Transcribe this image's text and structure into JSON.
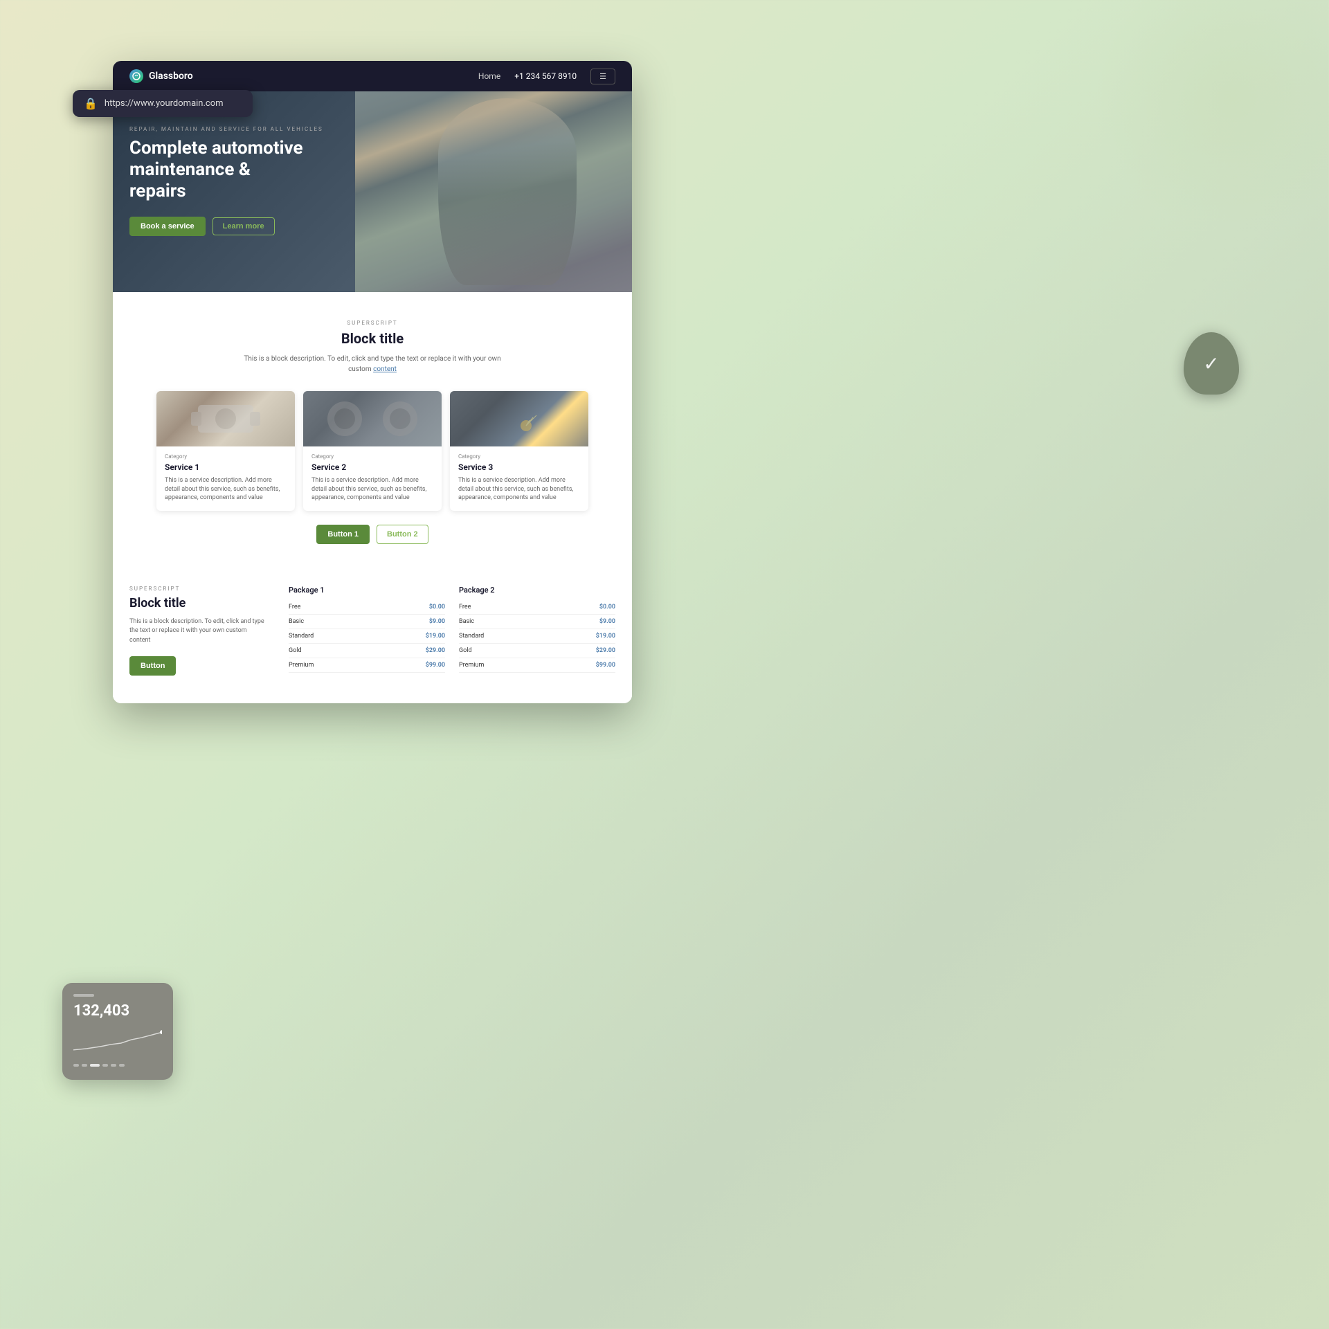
{
  "background": {
    "gradient": "linear-gradient(135deg, #e8e8c8 0%, #d4e8c8 40%, #c8d8c0 70%, #d0e0c0 100%)"
  },
  "browser": {
    "url": "https://www.yourdomain.com"
  },
  "nav": {
    "logo": "Glassboro",
    "home_link": "Home",
    "phone": "+1 234 567 8910",
    "button_label": "☰"
  },
  "hero": {
    "superscript": "REPAIR, MAINTAIN AND SERVICE FOR ALL VEHICLES",
    "title": "Complete automotive maintenance & repairs",
    "book_button": "Book a service",
    "learn_button": "Learn more"
  },
  "services": {
    "superscript": "SUPERSCRIPT",
    "title": "Block title",
    "description_part1": "This is a block description. To edit, click and type the text or replace it with your own custom",
    "description_link": "content",
    "cards": [
      {
        "category": "Category",
        "title": "Service 1",
        "description": "This is a service description. Add more detail about this service, such as benefits, appearance, components and value"
      },
      {
        "category": "Category",
        "title": "Service 2",
        "description": "This is a service description. Add more detail about this service, such as benefits, appearance, components and value"
      },
      {
        "category": "Category",
        "title": "Service 3",
        "description": "This is a service description. Add more detail about this service, such as benefits, appearance, components and value"
      }
    ],
    "button1": "Button 1",
    "button2": "Button 2"
  },
  "pricing": {
    "superscript": "SUPERSCRIPT",
    "title": "Block title",
    "description": "This is a block description. To edit, click and type the text or replace it with your own custom content",
    "button": "Button",
    "package1": {
      "title": "Package 1",
      "rows": [
        {
          "label": "Free",
          "price": "$0.00"
        },
        {
          "label": "Basic",
          "price": "$9.00"
        },
        {
          "label": "Standard",
          "price": "$19.00"
        },
        {
          "label": "Gold",
          "price": "$29.00"
        },
        {
          "label": "Premium",
          "price": "$99.00"
        }
      ]
    },
    "package2": {
      "title": "Package 2",
      "rows": [
        {
          "label": "Free",
          "price": "$0.00"
        },
        {
          "label": "Basic",
          "price": "$9.00"
        },
        {
          "label": "Standard",
          "price": "$19.00"
        },
        {
          "label": "Gold",
          "price": "$29.00"
        },
        {
          "label": "Premium",
          "price": "$99.00"
        }
      ]
    }
  },
  "stats_card": {
    "number": "132,403"
  },
  "shield": {
    "icon": "✓"
  }
}
